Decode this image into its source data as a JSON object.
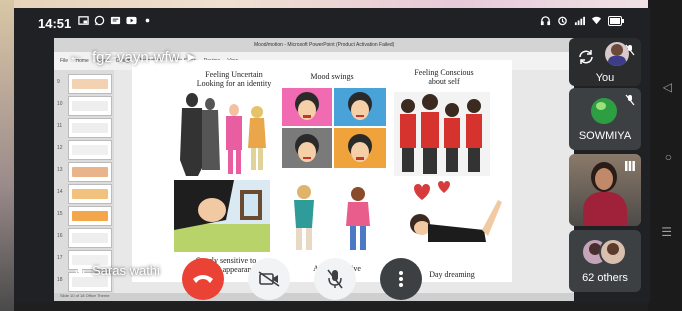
{
  "status_bar": {
    "time": "14:51",
    "left_icons": [
      "picture-in-picture-icon",
      "whatsapp-icon",
      "message-icon",
      "youtube-icon",
      "dot-icon"
    ],
    "right_icons": [
      "headset-icon",
      "alarm-icon",
      "signal-icon",
      "wifi-icon",
      "battery-icon"
    ]
  },
  "meeting": {
    "name": "fgz-vayn-wfw",
    "presenter": "Saras wathi"
  },
  "powerpoint": {
    "window_title": "Mood/motion - Microsoft PowerPoint (Product Activation Failed)",
    "ribbon_tabs": [
      "File",
      "Home",
      "Insert",
      "Design",
      "Animations",
      "Slide Show",
      "Review",
      "View"
    ],
    "thumbnails": [
      "9",
      "10",
      "11",
      "12",
      "13",
      "14",
      "15",
      "16",
      "17",
      "18"
    ],
    "status_text": "Slide 10 of 18  Office Theme"
  },
  "slide": {
    "labels": {
      "top_left": "Feeling Uncertain\nLooking for an identity",
      "top_middle": "Mood swings",
      "top_right": "Feeling Conscious\nabout self",
      "bottom_left": "Overly sensitive to\nPhysical appearance",
      "bottom_middle": "Argumentative",
      "bottom_right": "Day dreaming"
    }
  },
  "controls": {
    "end_call": "end-call-icon",
    "camera": "camera-off-icon",
    "mic": "mic-off-icon",
    "more": "more-vert-icon"
  },
  "participants": {
    "you": {
      "label": "You"
    },
    "sowmiya": {
      "label": "SOWMIYA"
    },
    "others": {
      "label": "62 others"
    }
  },
  "colors": {
    "end_call": "#ea4335",
    "control_light": "#f1f3f4",
    "tile_bg": "#3c4043",
    "sowmiya_avatar": "#2e9e43"
  }
}
